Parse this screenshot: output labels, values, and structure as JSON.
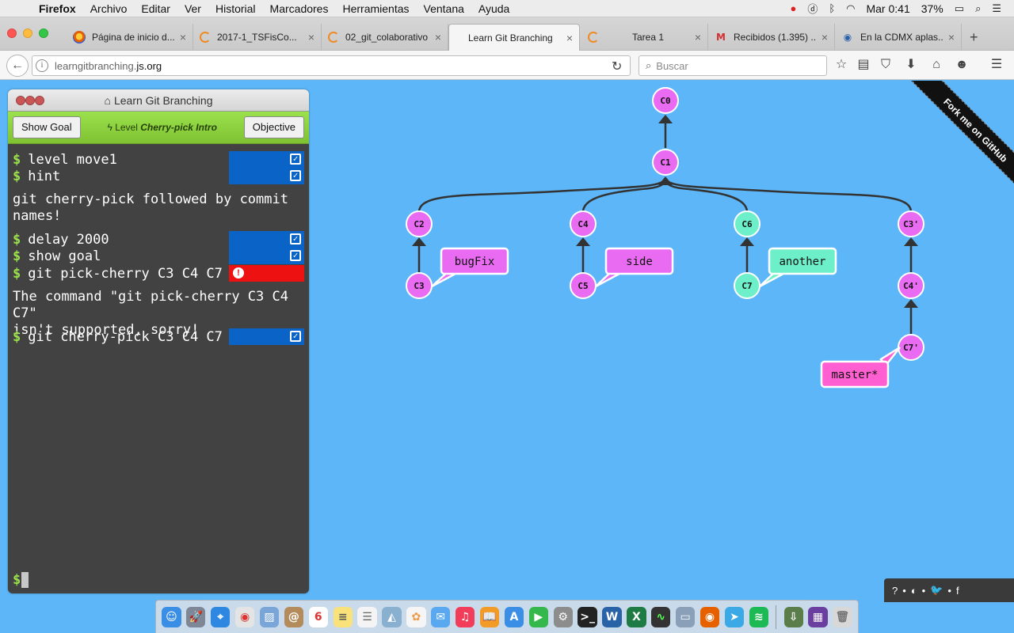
{
  "menubar": {
    "app_name": "Firefox",
    "items": [
      "Archivo",
      "Editar",
      "Ver",
      "Historial",
      "Marcadores",
      "Herramientas",
      "Ventana",
      "Ayuda"
    ],
    "clock": "Mar 0:41",
    "battery": "37%"
  },
  "tabs": [
    {
      "label": "Página de inicio d...",
      "icon": "firefox-icon"
    },
    {
      "label": "2017-1_TSFisCo...",
      "icon": "loading-icon"
    },
    {
      "label": "02_git_colaborativo",
      "icon": "loading-icon"
    },
    {
      "label": "Learn Git Branching",
      "icon": "none",
      "active": true
    },
    {
      "label": "Tarea 1",
      "icon": "loading-icon"
    },
    {
      "label": "Recibidos (1.395) ...",
      "icon": "gmail-icon"
    },
    {
      "label": "En la CDMX aplas...",
      "icon": "globe-icon"
    }
  ],
  "navbar": {
    "url_host": "learngitbranching.",
    "url_domain": "js.org",
    "search_placeholder": "Buscar"
  },
  "terminal": {
    "title": "Learn Git Branching",
    "show_goal_label": "Show Goal",
    "level_prefix": "Level",
    "level_name": "Cherry-pick Intro",
    "objective_label": "Objective",
    "commands": [
      {
        "text": "level move1",
        "status": "ok"
      },
      {
        "text": "hint",
        "status": "ok"
      },
      {
        "text": "delay 2000",
        "status": "ok"
      },
      {
        "text": "show goal",
        "status": "ok"
      },
      {
        "text": "git pick-cherry C3 C4 C7",
        "status": "error"
      },
      {
        "text": "git cherry-pick C3 C4 C7",
        "status": "ok"
      }
    ],
    "outputs": [
      "git cherry-pick followed by commit\nnames!",
      "The command \"git pick-cherry C3 C4 C7\"\nisn't supported, sorry!"
    ],
    "prompt": "$"
  },
  "graph": {
    "commits": [
      "C0",
      "C1",
      "C2",
      "C3",
      "C4",
      "C5",
      "C6",
      "C7",
      "C3'",
      "C4'",
      "C7'"
    ],
    "branches": [
      {
        "name": "bugFix",
        "target": "C3",
        "color": "#e86bf2"
      },
      {
        "name": "side",
        "target": "C5",
        "color": "#e86bf2"
      },
      {
        "name": "another",
        "target": "C7",
        "color": "#6df0c9"
      },
      {
        "name": "master*",
        "target": "C7'",
        "color": "#ff5fd1"
      }
    ],
    "colors": {
      "purple": "#e86bf2",
      "teal": "#6df0c9",
      "pink": "#ff5fd1",
      "background": "#5cb6f7"
    }
  },
  "ribbon": {
    "label": "Fork me on GitHub"
  },
  "helper": {
    "items": [
      "?",
      "•",
      "◐",
      "•",
      "🐦",
      "•",
      "f"
    ]
  },
  "dock": {
    "count": 31
  }
}
